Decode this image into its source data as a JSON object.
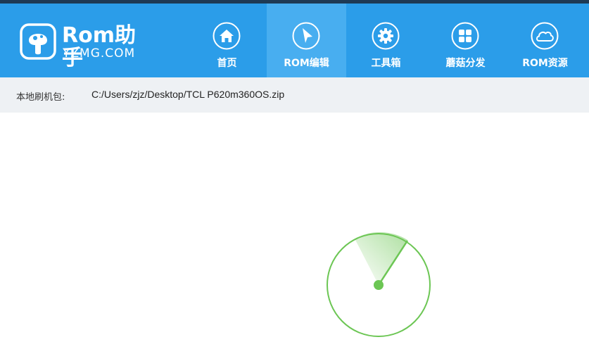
{
  "app": {
    "logo_name": "Rom助手",
    "logo_site": "YZMG.COM"
  },
  "nav": [
    {
      "label": "首页",
      "icon": "home-icon",
      "active": false
    },
    {
      "label": "ROM编辑",
      "icon": "cursor-arrow-icon",
      "active": true
    },
    {
      "label": "工具箱",
      "icon": "gear-icon",
      "active": false
    },
    {
      "label": "蘑菇分发",
      "icon": "grid-icon",
      "active": false
    },
    {
      "label": "ROM资源",
      "icon": "cloud-icon",
      "active": false
    }
  ],
  "pathbar": {
    "label": "本地刷机包:",
    "value": "C:/Users/zjz/Desktop/TCL P620m360OS.zip"
  },
  "loading": {
    "indicator": "radar-spinner-icon",
    "color": "#6cc654"
  },
  "colors": {
    "header": "#2b9de9",
    "active_tab": "#48aef0",
    "pathbar": "#eef1f4"
  }
}
